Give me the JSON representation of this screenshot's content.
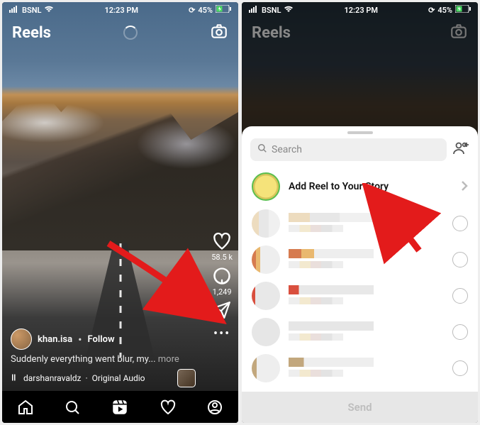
{
  "status": {
    "carrier": "BSNL",
    "time": "12:23 PM",
    "battery": "45%"
  },
  "left": {
    "title": "Reels",
    "like_count": "58.5 k",
    "comment_count": "1,249",
    "username": "khan.isa",
    "follow": "Follow",
    "caption": "Suddenly everything went blur, my...",
    "more": "more",
    "audio_user": "darshanravaldz",
    "audio_label": "Original Audio"
  },
  "right": {
    "title": "Reels",
    "search_placeholder": "Search",
    "add_story": "Add Reel to Your Story",
    "send": "Send"
  }
}
